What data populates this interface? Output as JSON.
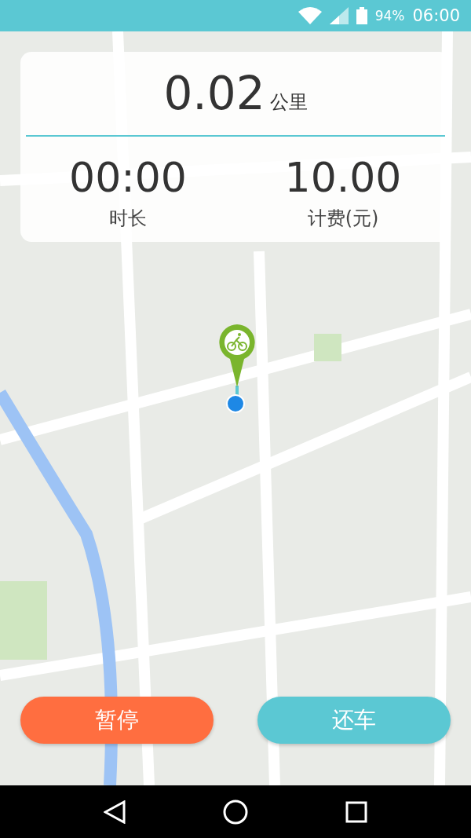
{
  "status_bar": {
    "battery": "94%",
    "time": "06:00"
  },
  "trip": {
    "distance": "0.02",
    "distance_unit": "公里",
    "stats": [
      {
        "value": "00:00",
        "label": "时长"
      },
      {
        "value": "10.00",
        "label": "计费(元)"
      }
    ]
  },
  "buttons": [
    {
      "label": "暂停",
      "kind": "pause"
    },
    {
      "label": "还车",
      "kind": "return"
    }
  ]
}
